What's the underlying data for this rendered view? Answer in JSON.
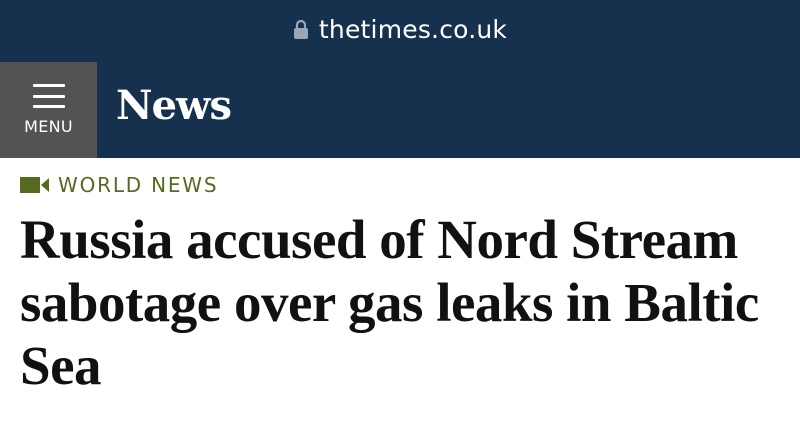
{
  "browser": {
    "url": "thetimes.co.uk",
    "lock_icon": "lock-icon"
  },
  "nav": {
    "menu_label": "MENU",
    "menu_icon": "hamburger-icon",
    "section_title": "News"
  },
  "article": {
    "category": "WORLD NEWS",
    "category_icon": "video-icon",
    "headline": "Russia accused of Nord Stream sabotage over gas leaks in Baltic Sea"
  },
  "colors": {
    "header_bg": "#15314d",
    "menu_bg": "#555252",
    "category": "#566b20",
    "headline": "#111111"
  }
}
